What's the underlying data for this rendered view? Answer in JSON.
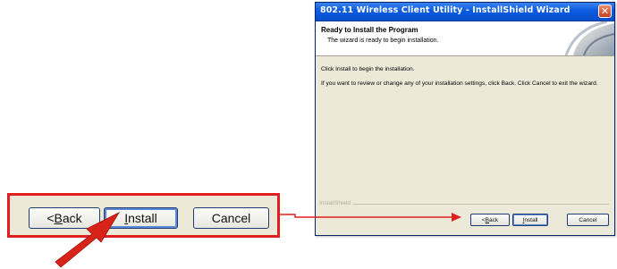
{
  "dialog": {
    "title": "802.11 Wireless Client Utility - InstallShield Wizard",
    "close_glyph": "✕",
    "header_title": "Ready to Install the Program",
    "header_subtitle": "The wizard is ready to begin installation.",
    "body_line1": "Click Install to begin the installation.",
    "body_line2": "If you want to review or change any of your installation settings, click Back. Click Cancel to exit the wizard.",
    "brand": "InstallShield",
    "buttons": {
      "back_prefix": "< ",
      "back_mnemonic": "B",
      "back_rest": "ack",
      "install_mnemonic": "I",
      "install_rest": "nstall",
      "cancel": "Cancel"
    }
  },
  "callout": {
    "back_prefix": "< ",
    "back_mnemonic": "B",
    "back_rest": "ack",
    "install_mnemonic": "I",
    "install_rest": "nstall",
    "cancel": "Cancel"
  },
  "colors": {
    "highlight": "#e02020",
    "titlebar": "#0b5be0",
    "dialog_bg": "#ece9d8"
  },
  "icons": {
    "pointer_arrow": "red-arrow-icon",
    "connector": "red-connector-arrow-icon",
    "header_graphic": "installshield-header-graphic"
  }
}
